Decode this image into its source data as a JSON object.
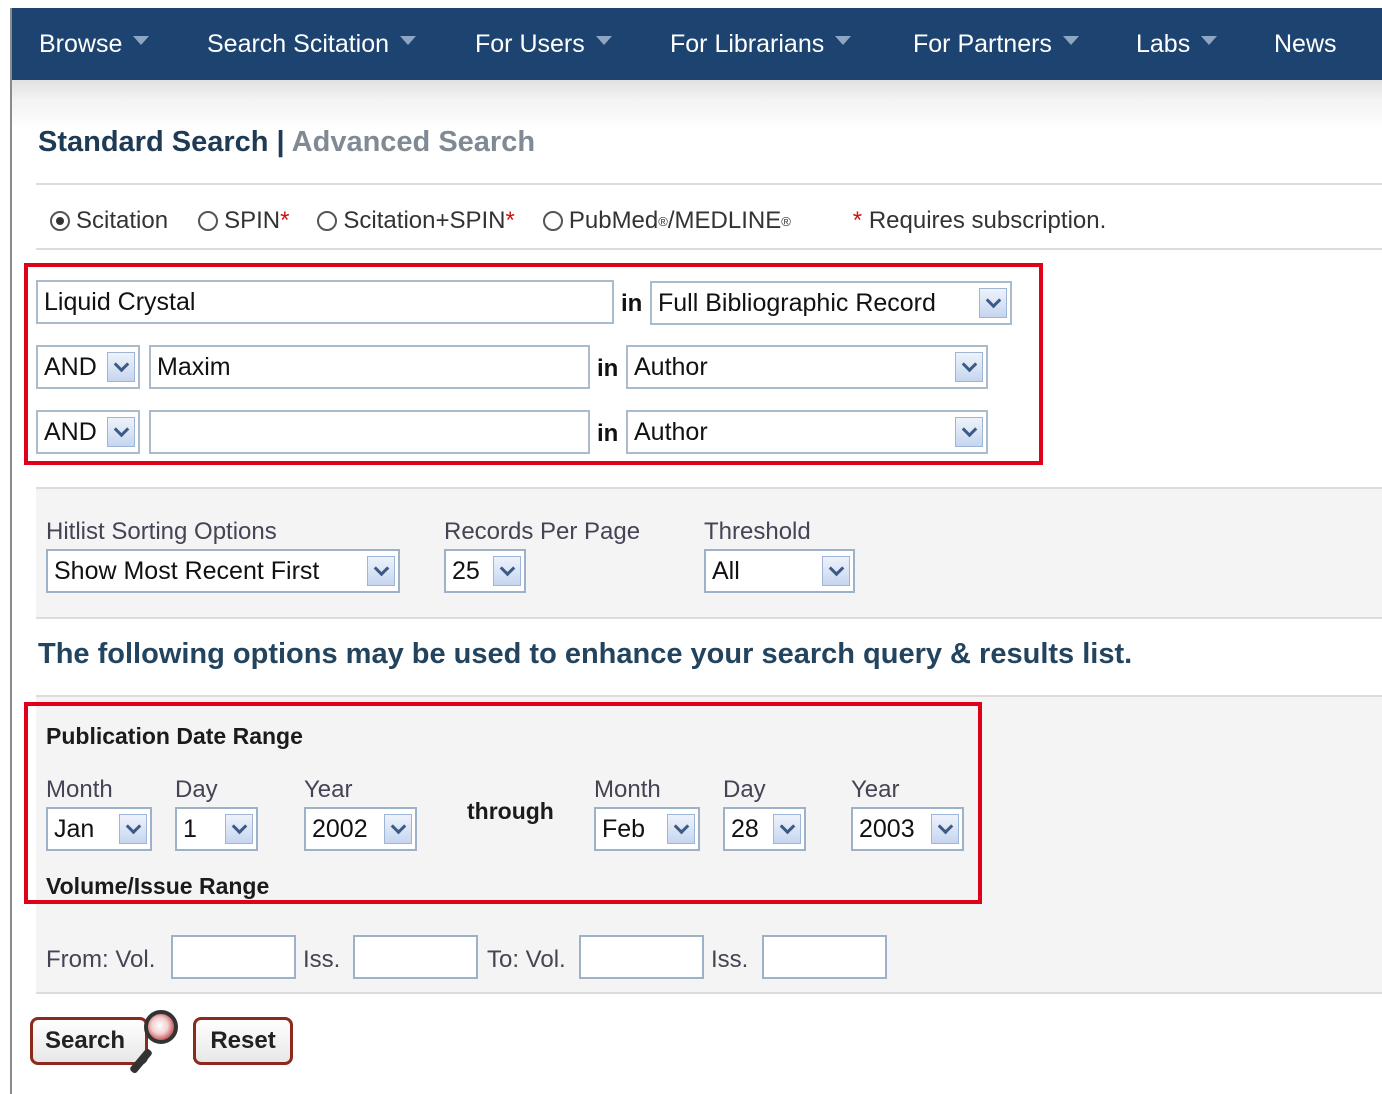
{
  "nav": {
    "items": [
      {
        "label": "Browse",
        "has_menu": true
      },
      {
        "label": "Search Scitation",
        "has_menu": true
      },
      {
        "label": "For Users",
        "has_menu": true
      },
      {
        "label": "For Librarians",
        "has_menu": true
      },
      {
        "label": "For Partners",
        "has_menu": true
      },
      {
        "label": "Labs",
        "has_menu": true
      },
      {
        "label": "News",
        "has_menu": false
      }
    ]
  },
  "search_tabs": {
    "standard": "Standard Search",
    "separator": "|",
    "advanced": "Advanced Search"
  },
  "databases": {
    "scitation": "Scitation",
    "spin": "SPIN",
    "scitation_spin": "Scitation+SPIN",
    "pubmed": "PubMed",
    "medline": "/MEDLINE",
    "reg": "®",
    "asterisk": "*",
    "subscription_note": "Requires subscription.",
    "selected": "Scitation"
  },
  "query": {
    "in_label": "in",
    "row1": {
      "value": "Liquid Crystal",
      "field": "Full Bibliographic Record"
    },
    "row2": {
      "operator": "AND",
      "value": "Maxim",
      "field": "Author"
    },
    "row3": {
      "operator": "AND",
      "value": "",
      "field": "Author"
    }
  },
  "hitlist": {
    "sorting_label": "Hitlist Sorting Options",
    "sorting_value": "Show Most Recent First",
    "records_label": "Records Per Page",
    "records_value": "25",
    "threshold_label": "Threshold",
    "threshold_value": "All"
  },
  "enhance_text": "The following options may be used to enhance your search query & results list.",
  "date_range": {
    "title": "Publication Date Range",
    "month_label": "Month",
    "day_label": "Day",
    "year_label": "Year",
    "through": "through",
    "from": {
      "month": "Jan",
      "day": "1",
      "year": "2002"
    },
    "to": {
      "month": "Feb",
      "day": "28",
      "year": "2003"
    }
  },
  "volume_range": {
    "title": "Volume/Issue Range",
    "from_vol": "From: Vol.",
    "iss": "Iss.",
    "to_vol": "To: Vol."
  },
  "buttons": {
    "search": "Search",
    "reset": "Reset"
  },
  "colors": {
    "nav_bg": "#1d4470",
    "highlight_border": "#e1001a",
    "button_border": "#8b2b1e"
  }
}
